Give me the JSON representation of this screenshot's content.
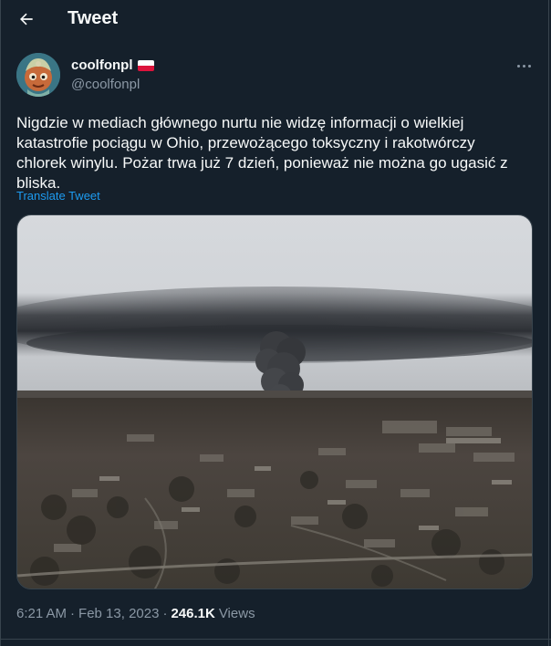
{
  "header": {
    "title": "Tweet",
    "back_icon": "arrow-left-icon"
  },
  "author": {
    "display_name": "coolfonpl",
    "handle": "@coolfonpl",
    "flag": "poland-flag-icon",
    "avatar": "avatar-image"
  },
  "tweet": {
    "text": "Nigdzie w mediach głównego nurtu nie widzę informacji o wielkiej katastrofie pociągu w Ohio, przewożącego toksyczny i rakotwórczy chlorek winylu. Pożar trwa już 7 dzień, ponieważ nie można go ugasić z bliska.",
    "translate_label": "Translate Tweet",
    "media": "aerial-photo-smoke-plume-over-town"
  },
  "meta": {
    "time": "6:21 AM",
    "separator": "·",
    "date": "Feb 13, 2023",
    "views_count": "246.1K",
    "views_label": "Views"
  },
  "colors": {
    "background": "#15202b",
    "text": "#f7f9f9",
    "secondary": "#8b98a5",
    "accent": "#1d9bf0",
    "border": "#38444d"
  }
}
